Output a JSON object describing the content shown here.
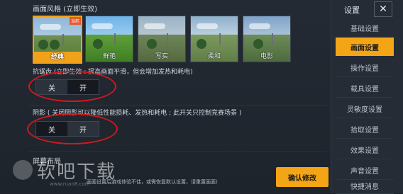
{
  "main": {
    "quality": {
      "title": "画面风格 (立即生效)",
      "options": [
        {
          "label": "经典",
          "selected": true,
          "tag": "当前"
        },
        {
          "label": "鲜艳",
          "selected": false
        },
        {
          "label": "写实",
          "selected": false
        },
        {
          "label": "柔和",
          "selected": false
        },
        {
          "label": "电影",
          "selected": false
        }
      ]
    },
    "antialias": {
      "desc": "抗锯齿 (立即生效 : 提高画面平滑，但会增加发热和耗电)",
      "off_label": "关",
      "on_label": "开",
      "value": "关"
    },
    "shadow": {
      "desc": "阴影 ( 关闭阴影可以降低性能损耗、发热和耗电 ; 此开关只控制竞赛场景 )",
      "off_label": "关",
      "on_label": "开",
      "value": "开"
    },
    "screen_section": {
      "title": "屏幕布局"
    },
    "bottom_note": "画面设置后游戏体验不佳，或需恢复默认设置，请重置画面)",
    "confirm_label": "确认修改",
    "accent_color": "#f3a515"
  },
  "watermark": {
    "text": "软吧下载",
    "url": "www.ruan8.com"
  },
  "sidebar": {
    "title": "设置",
    "close_icon": "close-icon",
    "items": [
      {
        "label": "基础设置",
        "active": false
      },
      {
        "label": "画面设置",
        "active": true
      },
      {
        "label": "操作设置",
        "active": false
      },
      {
        "label": "载具设置",
        "active": false
      },
      {
        "label": "灵敏度设置",
        "active": false
      },
      {
        "label": "拾取设置",
        "active": false
      },
      {
        "label": "效果设置",
        "active": false
      },
      {
        "label": "声音设置",
        "active": false
      },
      {
        "label": "快捷消息",
        "active": false
      }
    ]
  }
}
